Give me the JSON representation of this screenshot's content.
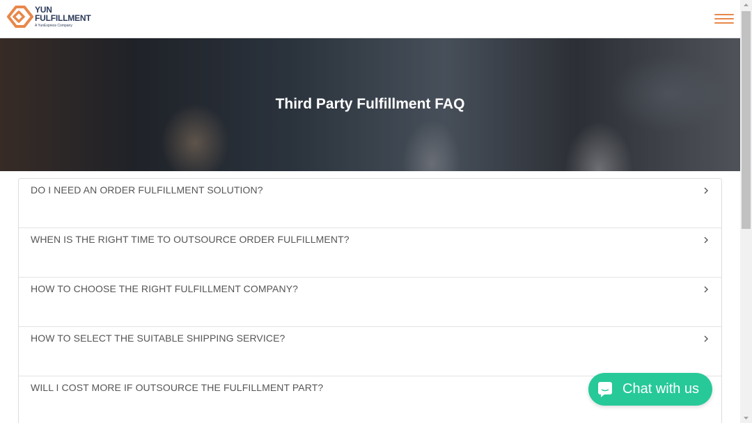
{
  "logo": {
    "line1": "YUN",
    "line2": "FULFILLMENT",
    "sub": "A YunExpress Company",
    "color": "#e8874a"
  },
  "header": {
    "menu_icon": "hamburger-menu-icon",
    "menu_color": "#e8874a"
  },
  "hero": {
    "title": "Third Party Fulfillment FAQ"
  },
  "faq": {
    "items": [
      {
        "question": "DO I NEED AN ORDER FULFILLMENT SOLUTION?"
      },
      {
        "question": "WHEN IS THE RIGHT TIME TO OUTSOURCE ORDER FULFILLMENT?"
      },
      {
        "question": "HOW TO CHOOSE THE RIGHT FULFILLMENT COMPANY?"
      },
      {
        "question": "HOW TO SELECT THE SUITABLE SHIPPING SERVICE?"
      },
      {
        "question": "WILL I COST MORE IF OUTSOURCE THE FULFILLMENT PART?"
      }
    ]
  },
  "chat": {
    "label": "Chat with us",
    "color": "#27c999",
    "icon": "chat-bubble-icon"
  }
}
